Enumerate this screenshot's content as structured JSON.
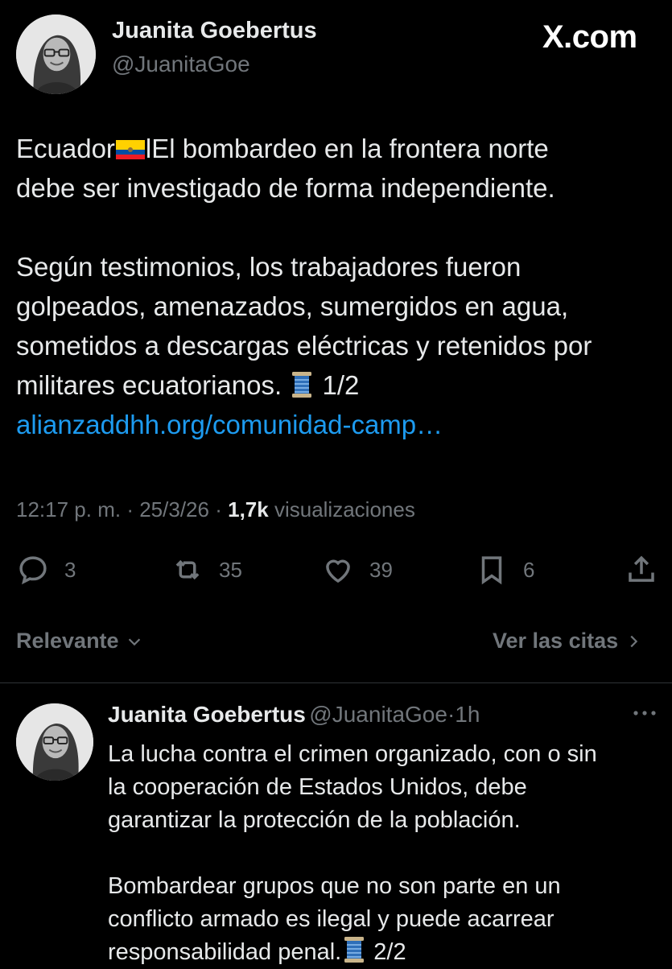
{
  "header": {
    "author_name": "Juanita Goebertus",
    "author_handle": "@JuanitaGoe",
    "brand": "X.com",
    "avatar_icon": "profile-photo"
  },
  "tweet": {
    "line1_start": "Ecuador",
    "line1_end": "lEl bombardeo en la frontera norte",
    "line2": "debe ser investigado de forma independiente.",
    "line3": "Según testimonios, los trabajadores fueron",
    "line4": "golpeados, amenazados, sumergidos en agua,",
    "line5": "sometidos a descargas eléctricas y retenidos por",
    "line6_start": "militares ecuatorianos.",
    "line6_end": "1/2",
    "link": "alianzaddhh.org/comunidad-camp…",
    "flag_icon": "ecuador-flag-emoji",
    "thread_icon": "spool-of-thread-emoji"
  },
  "meta": {
    "time": "12:17 p. m.",
    "sep1": "·",
    "date": "25/3/26",
    "sep2": "·",
    "views_count": "1,7k",
    "views_label": "visualizaciones"
  },
  "actions": {
    "replies": "3",
    "reposts": "35",
    "likes": "39",
    "bookmarks": "6",
    "icons": [
      "reply-icon",
      "repost-icon",
      "like-icon",
      "bookmark-icon",
      "share-icon"
    ]
  },
  "filters": {
    "sort_label": "Relevante",
    "quotes_label": "Ver las citas"
  },
  "reply": {
    "author_name": "Juanita Goebertus",
    "author_handle": "@JuanitaGoe",
    "sep": "·",
    "time": "1h",
    "more_icon": "more-icon",
    "line1": "La lucha contra el crimen organizado, con o sin",
    "line2": "la cooperación de Estados Unidos, debe",
    "line3": "garantizar la protección de la población.",
    "line4": "Bombardear grupos que no son parte en un",
    "line5": "conflicto armado es ilegal y puede acarrear",
    "line6_start": "responsabilidad penal.",
    "line6_end": "2/2"
  },
  "colors": {
    "background": "#000000",
    "text": "#e7e9ea",
    "secondary": "#71767b",
    "link": "#1d9bf0",
    "divider": "#2f3336"
  }
}
